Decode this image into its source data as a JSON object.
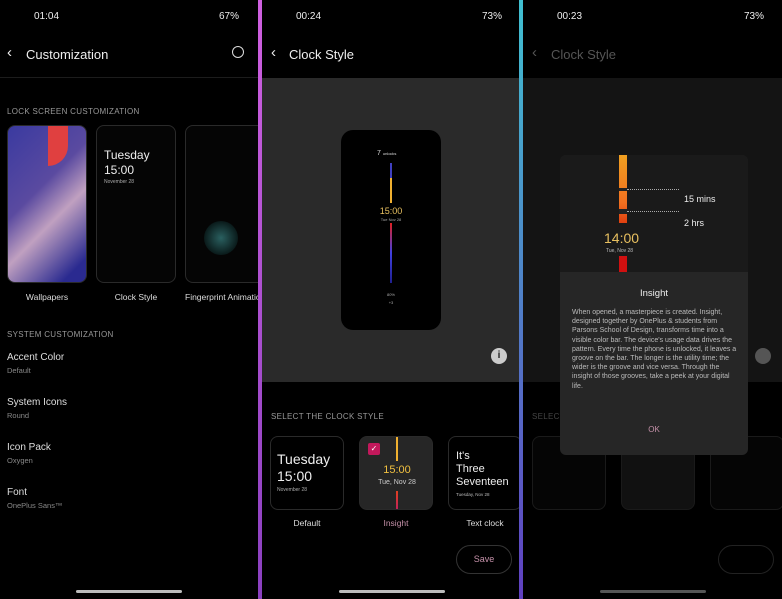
{
  "panel1": {
    "time": "01:04",
    "battery": "67%",
    "title": "Customization",
    "lock_section": "LOCK SCREEN CUSTOMIZATION",
    "cards": [
      {
        "label": "Wallpapers"
      },
      {
        "label": "Clock Style",
        "preview_day": "Tuesday",
        "preview_time": "15:00",
        "preview_date": "November 28"
      },
      {
        "label": "Fingerprint Animatio"
      }
    ],
    "system_section": "SYSTEM CUSTOMIZATION",
    "items": [
      {
        "title": "Accent Color",
        "value": "Default"
      },
      {
        "title": "System Icons",
        "value": "Round"
      },
      {
        "title": "Icon Pack",
        "value": "Oxygen"
      },
      {
        "title": "Font",
        "value": "OnePlus Sans™"
      }
    ]
  },
  "panel2": {
    "time": "00:24",
    "battery": "73%",
    "title": "Clock Style",
    "preview": {
      "unlocks_count": "7",
      "unlocks_label": "unlocks",
      "time": "15:00",
      "date": "Tue Nov 28",
      "battery": "80%",
      "more": "+3"
    },
    "select_section": "SELECT THE CLOCK STYLE",
    "styles": [
      {
        "label": "Default",
        "day": "Tuesday",
        "time": "15:00",
        "date": "November 28"
      },
      {
        "label": "Insight",
        "time": "15:00",
        "date": "Tue, Nov 28",
        "selected": true
      },
      {
        "label": "Text clock",
        "line1": "It's",
        "line2": "Three",
        "line3": "Seventeen",
        "date": "Tuesday, Nov 28"
      }
    ],
    "save": "Save"
  },
  "panel3": {
    "time": "00:23",
    "battery": "73%",
    "title": "Clock Style",
    "select_section": "SELECT THE CLOCK STYLE",
    "dialog": {
      "groove1": "15 mins",
      "groove2": "2 hrs",
      "time": "14:00",
      "date": "Tue, Nov 28",
      "title": "Insight",
      "body": "When opened, a masterpiece is created. Insight, designed together by OnePlus & students from Parsons School of Design, transforms time into a visible color bar. The device's usage data drives the pattern. Every time the phone is unlocked, it leaves a groove on the bar. The longer is the utility time; the wider is the groove and vice versa. Through the insight of those grooves, take a peek at your digital life.",
      "ok": "OK"
    }
  },
  "colors": {
    "accent": "#c2185b",
    "insight_orange": "#f5a623",
    "insight_red": "#e53935"
  }
}
